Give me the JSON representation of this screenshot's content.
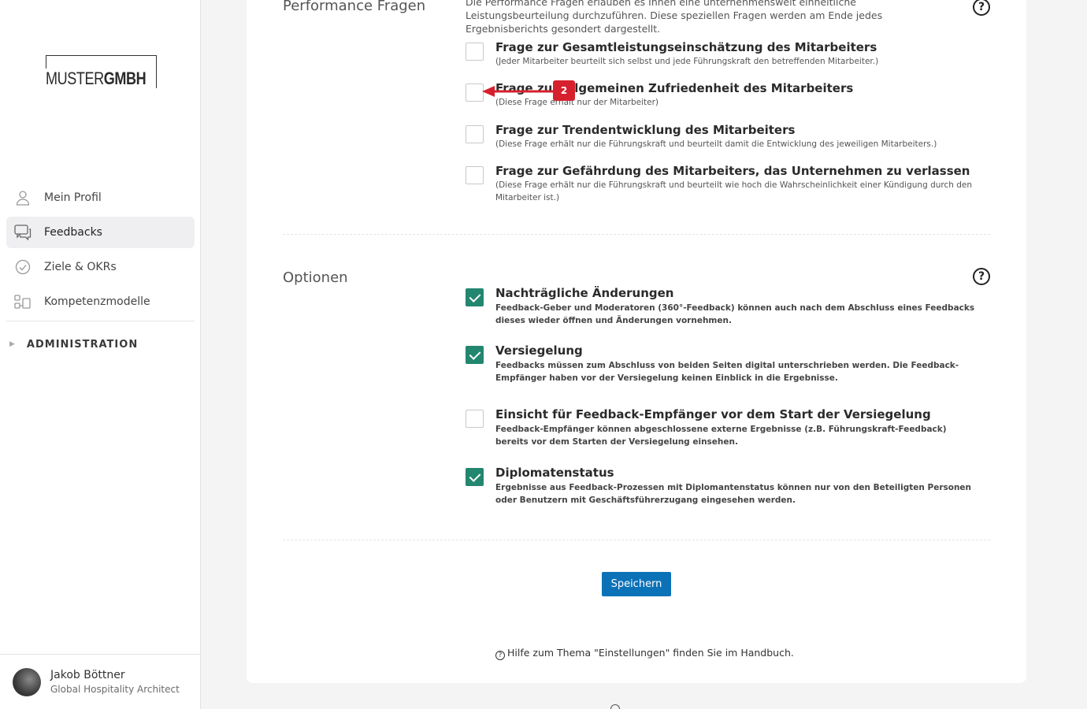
{
  "logo": {
    "part1": "MUSTER",
    "part2": "GMBH"
  },
  "nav": {
    "items": [
      {
        "label": "Mein Profil",
        "icon": "user-icon"
      },
      {
        "label": "Feedbacks",
        "icon": "chat-icon"
      },
      {
        "label": "Ziele & OKRs",
        "icon": "check-circle-icon"
      },
      {
        "label": "Kompetenzmodelle",
        "icon": "grid-icon"
      }
    ],
    "admin_label": "ADMINISTRATION"
  },
  "user": {
    "name": "Jakob Böttner",
    "role": "Global Hospitality Architect"
  },
  "performance": {
    "title": "Performance Fragen",
    "intro": "Die Performance Fragen erlauben es Ihnen eine unternehmensweit einheitliche Leistungsbeurteilung durchzuführen. Diese speziellen Fragen werden am Ende jedes Ergebnisberichts gesondert dargestellt.",
    "items": [
      {
        "title": "Frage zur Gesamtleistungseinschätzung des Mitarbeiters",
        "desc": "(Jeder Mitarbeiter beurteilt sich selbst und jede Führungskraft den betreffenden Mitarbeiter.)"
      },
      {
        "title": "Frage zur allgemeinen Zufriedenheit des Mitarbeiters",
        "desc": "(Diese Frage erhält nur der Mitarbeiter)"
      },
      {
        "title": "Frage zur Trendentwicklung des Mitarbeiters",
        "desc": "(Diese Frage erhält nur die Führungskraft und beurteilt damit die Entwicklung des jeweiligen Mitarbeiters.)"
      },
      {
        "title": "Frage zur Gefährdung des Mitarbeiters, das Unternehmen zu verlassen",
        "desc": "(Diese Frage erhält nur die Führungskraft und beurteilt wie hoch die Wahrscheinlichkeit einer Kündigung durch den Mitarbeiter ist.)"
      }
    ]
  },
  "options": {
    "title": "Optionen",
    "items": [
      {
        "title": "Nachträgliche Änderungen",
        "desc": "Feedback-Geber und Moderatoren (360°-Feedback) können auch nach dem Abschluss eines Feedbacks dieses wieder öffnen und Änderungen vornehmen.",
        "checked": true
      },
      {
        "title": "Versiegelung",
        "desc": "Feedbacks müssen zum Abschluss von beiden Seiten digital unterschrieben werden. Die Feedback-Empfänger haben vor der Versiegelung keinen Einblick in die Ergebnisse.",
        "checked": true
      },
      {
        "title": "Einsicht für Feedback-Empfänger vor dem Start der Versiegelung",
        "desc": "Feedback-Empfänger können abgeschlossene externe Ergebnisse (z.B. Führungskraft-Feedback) bereits vor dem Starten der Versiegelung einsehen.",
        "checked": false
      },
      {
        "title": "Diplomatenstatus",
        "desc": "Ergebnisse aus Feedback-Prozessen mit Diplomantenstatus können nur von den Beteiligten Personen oder Benutzern mit Geschäftsführerzugang eingesehen werden.",
        "checked": true
      }
    ]
  },
  "save_label": "Speichern",
  "footer_help": "Hilfe zum Thema \"Einstellungen\" finden Sie im Handbuch.",
  "help_glyph": "?",
  "annotation": {
    "number": "2"
  },
  "colors": {
    "accent": "#23866f",
    "primary_button": "#0c72b8",
    "annotation": "#d6202e"
  }
}
